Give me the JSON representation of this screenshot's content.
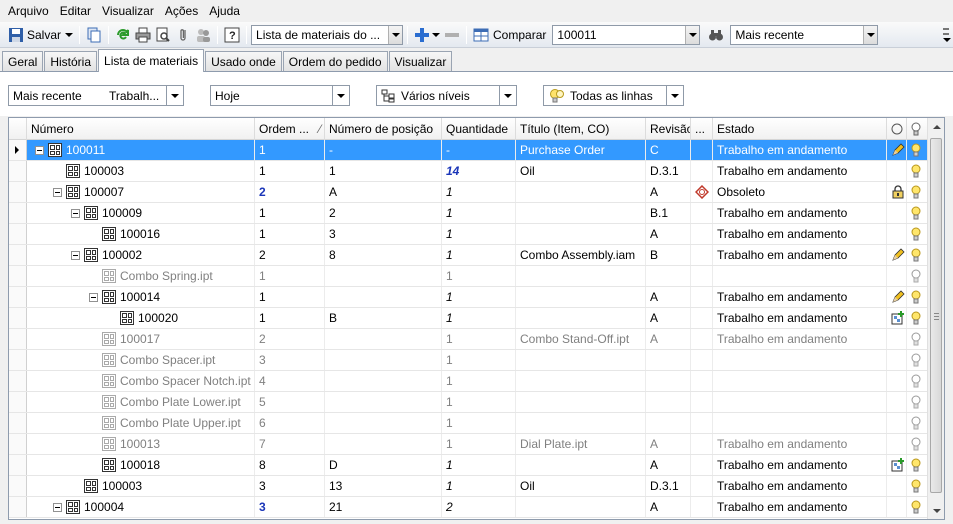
{
  "menu": [
    "Arquivo",
    "Editar",
    "Visualizar",
    "Ações",
    "Ajuda"
  ],
  "toolbar": {
    "save_label": "Salvar",
    "list_combo": "Lista de materiais do ...",
    "compare_label": "Comparar",
    "compare_value": "100011",
    "version_value": "Mais recente"
  },
  "tabs": [
    "Geral",
    "História",
    "Lista de materiais",
    "Usado onde",
    "Ordem do pedido",
    "Visualizar"
  ],
  "active_tab": 2,
  "filters": {
    "version": "Mais recente",
    "state": "Trabalh...",
    "date": "Hoje",
    "levels": "Vários níveis",
    "lines": "Todas as linhas"
  },
  "columns": [
    "Número",
    "Ordem ...",
    "Número de posição",
    "Quantidade",
    "Título (Item, CO)",
    "Revisão",
    "...",
    "Estado"
  ],
  "rows": [
    {
      "number": "100011",
      "order": "1",
      "position": "-",
      "qty": "-",
      "title": "Purchase Order",
      "rev": "C",
      "state": "Trabalho em andamento",
      "level": 0,
      "expand": true,
      "selected": true,
      "pencil": true
    },
    {
      "number": "100003",
      "order": "1",
      "position": "1",
      "qty": "14",
      "title": "Oil",
      "rev": "D.3.1",
      "state": "Trabalho em andamento",
      "level": 1,
      "qty_style": "blue-bold"
    },
    {
      "number": "100007",
      "order": "2",
      "position": "A",
      "qty": "1",
      "title": "",
      "rev": "A",
      "state": "Obsoleto",
      "level": 1,
      "expand": true,
      "order_style": "blue-dark",
      "obsolete": true,
      "lock": true
    },
    {
      "number": "100009",
      "order": "1",
      "position": "2",
      "qty": "1",
      "title": "",
      "rev": "B.1",
      "state": "Trabalho em andamento",
      "level": 2,
      "expand": true
    },
    {
      "number": "100016",
      "order": "1",
      "position": "3",
      "qty": "1",
      "title": "",
      "rev": "A",
      "state": "Trabalho em andamento",
      "level": 3
    },
    {
      "number": "100002",
      "order": "2",
      "position": "8",
      "qty": "1",
      "title": "Combo Assembly.iam",
      "rev": "B",
      "state": "Trabalho em andamento",
      "level": 2,
      "expand": true,
      "pencil": true
    },
    {
      "number": "Combo Spring.ipt",
      "order": "1",
      "position": "",
      "qty": "1",
      "title": "",
      "rev": "",
      "state": "",
      "level": 3,
      "grey": true
    },
    {
      "number": "100014",
      "order": "1",
      "position": "",
      "qty": "1",
      "title": "",
      "rev": "A",
      "state": "Trabalho em andamento",
      "level": 3,
      "expand": true,
      "pencil": true
    },
    {
      "number": "100020",
      "order": "1",
      "position": "B",
      "qty": "1",
      "title": "",
      "rev": "A",
      "state": "Trabalho em andamento",
      "level": 4,
      "add": true
    },
    {
      "number": "100017",
      "order": "2",
      "position": "",
      "qty": "1",
      "title": "Combo Stand-Off.ipt",
      "rev": "A",
      "state": "Trabalho em andamento",
      "level": 3,
      "grey": true,
      "grey_state": true
    },
    {
      "number": "Combo Spacer.ipt",
      "order": "3",
      "position": "",
      "qty": "1",
      "title": "",
      "rev": "",
      "state": "",
      "level": 3,
      "grey": true
    },
    {
      "number": "Combo Spacer Notch.ipt",
      "order": "4",
      "position": "",
      "qty": "1",
      "title": "",
      "rev": "",
      "state": "",
      "level": 3,
      "grey": true
    },
    {
      "number": "Combo Plate Lower.ipt",
      "order": "5",
      "position": "",
      "qty": "1",
      "title": "",
      "rev": "",
      "state": "",
      "level": 3,
      "grey": true
    },
    {
      "number": "Combo Plate Upper.ipt",
      "order": "6",
      "position": "",
      "qty": "1",
      "title": "",
      "rev": "",
      "state": "",
      "level": 3,
      "grey": true
    },
    {
      "number": "100013",
      "order": "7",
      "position": "",
      "qty": "1",
      "title": "Dial Plate.ipt",
      "rev": "A",
      "state": "Trabalho em andamento",
      "level": 3,
      "grey": true,
      "grey_state": true
    },
    {
      "number": "100018",
      "order": "8",
      "position": "D",
      "qty": "1",
      "title": "",
      "rev": "A",
      "state": "Trabalho em andamento",
      "level": 3,
      "add": true
    },
    {
      "number": "100003",
      "order": "3",
      "position": "13",
      "qty": "1",
      "title": "Oil",
      "rev": "D.3.1",
      "state": "Trabalho em andamento",
      "level": 2
    },
    {
      "number": "100004",
      "order": "3",
      "position": "21",
      "qty": "2",
      "title": "",
      "rev": "A",
      "state": "Trabalho em andamento",
      "level": 1,
      "expand": true,
      "order_style": "blue-dark"
    }
  ]
}
